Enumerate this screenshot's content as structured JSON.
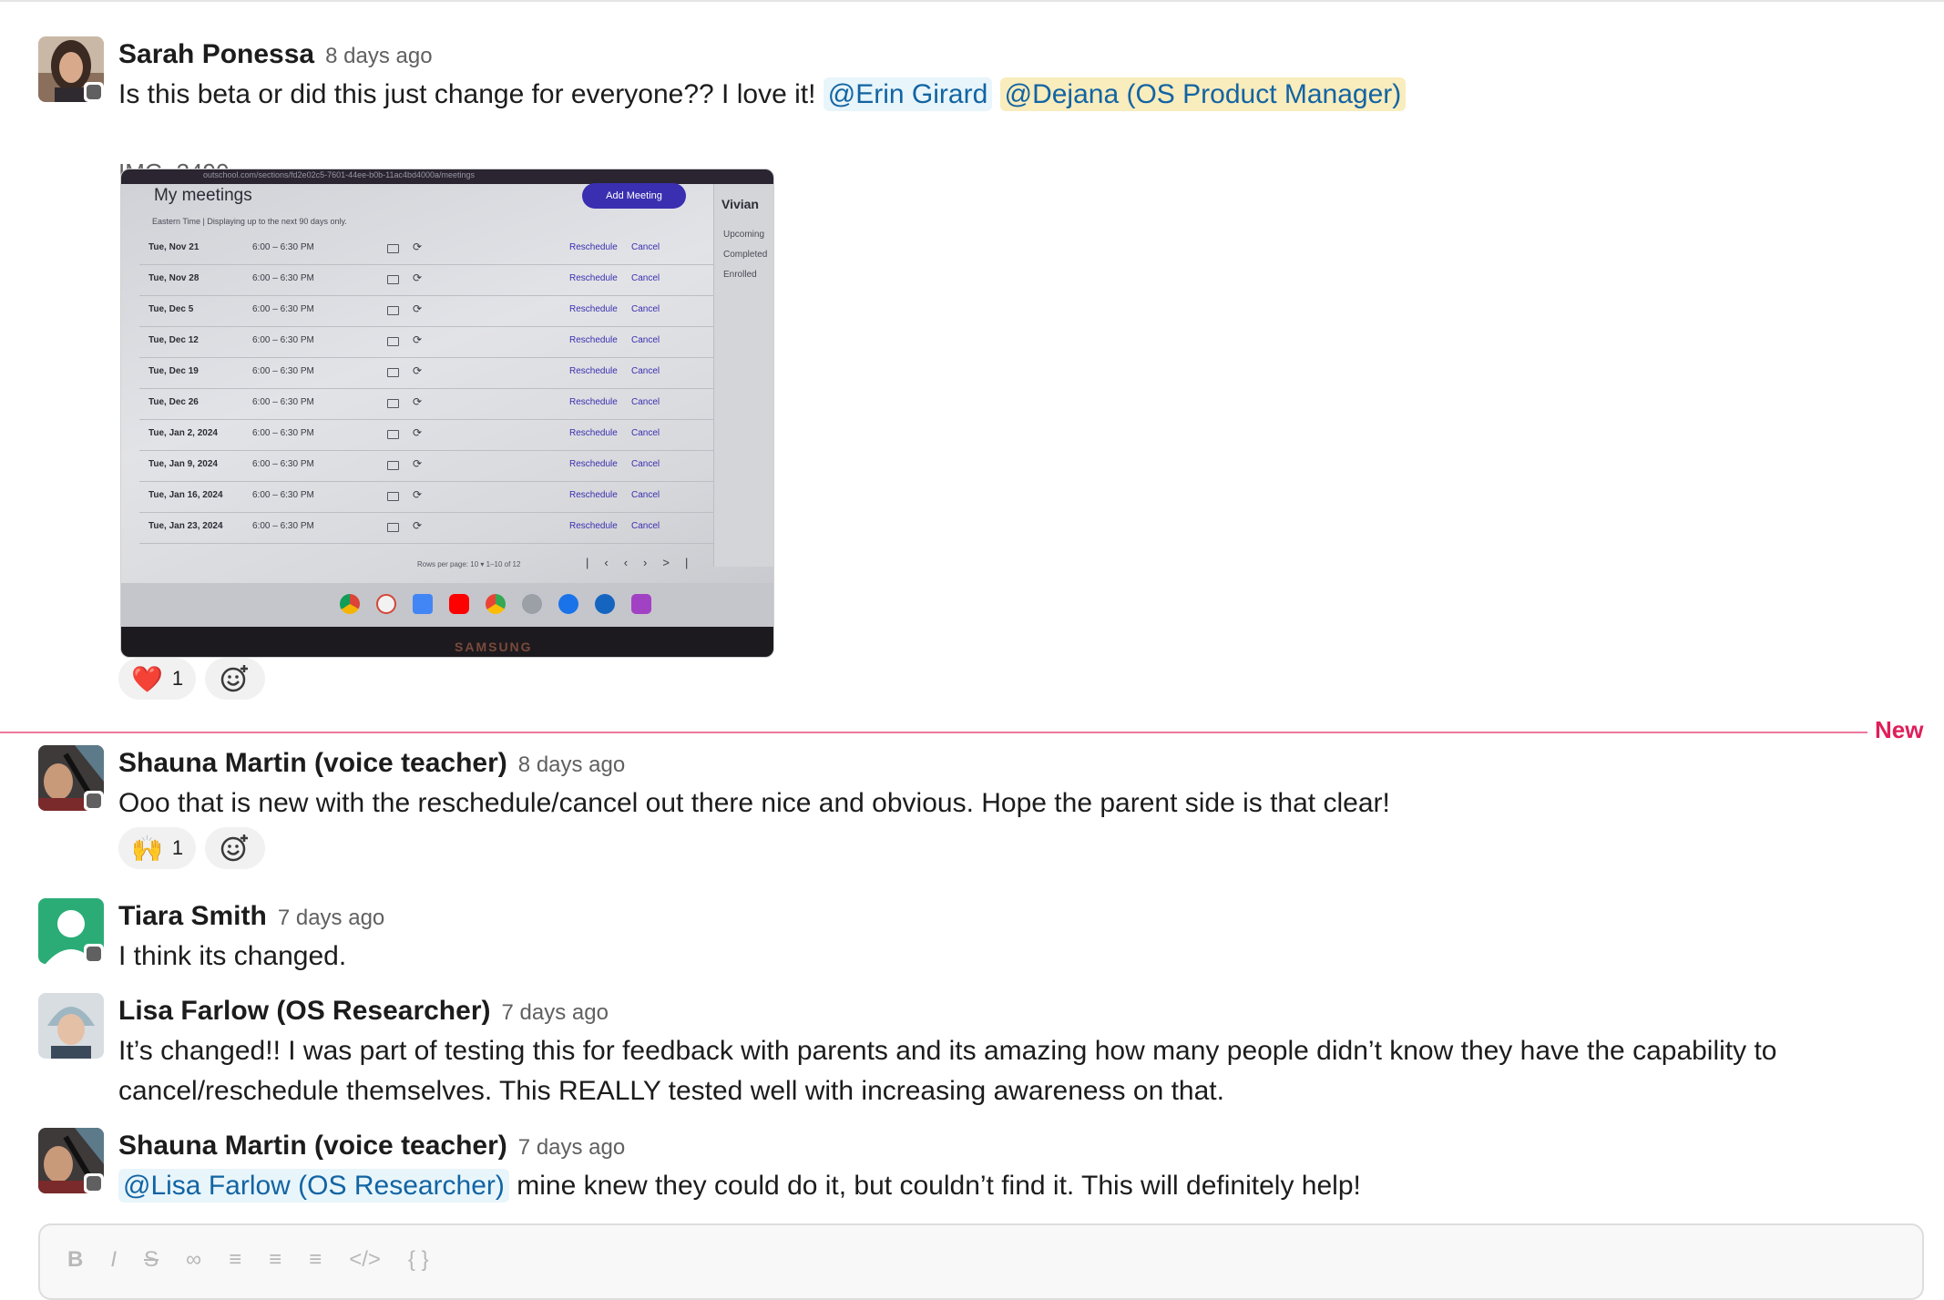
{
  "messages": [
    {
      "author": "Sarah Ponessa",
      "time": "8 days ago",
      "text_before": "Is this beta or did this just change for everyone?? I love it! ",
      "mention1": "@Erin Girard",
      "mention2": "@Dejana (OS Product Manager)",
      "file_name": "IMG_3490",
      "reaction": {
        "emoji": "❤️",
        "count": "1"
      }
    },
    {
      "author": "Shauna Martin (voice teacher)",
      "time": "8 days ago",
      "text": "Ooo that is new with the reschedule/cancel out there nice and obvious. Hope the parent side is that clear!",
      "reaction": {
        "emoji": "🙌",
        "count": "1"
      }
    },
    {
      "author": "Tiara Smith",
      "time": "7 days ago",
      "text": "I think its changed."
    },
    {
      "author": "Lisa Farlow (OS Researcher)",
      "time": "7 days ago",
      "text": "It’s changed!! I was part of testing this for feedback with parents and its amazing how many people didn’t know they have the capability to cancel/reschedule themselves. This REALLY tested well with increasing awareness on that."
    },
    {
      "author": "Shauna Martin (voice teacher)",
      "time": "7 days ago",
      "mention": "@Lisa Farlow (OS Researcher)",
      "text_after": " mine knew they could do it, but couldn’t find it. This will definitely help!"
    }
  ],
  "divider_label": "New",
  "attachment": {
    "url": "outschool.com/sections/fd2e02c5-7601-44ee-b0b-11ac4bd4000a/meetings",
    "title": "My meetings",
    "subtitle": "Eastern Time | Displaying up to the next 90 days only.",
    "add_button": "Add Meeting",
    "side_title": "Vivian",
    "side_items": [
      "Upcoming",
      "Completed",
      "Enrolled"
    ],
    "rows": [
      {
        "date": "Tue, Nov 21",
        "time": "6:00 – 6:30 PM"
      },
      {
        "date": "Tue, Nov 28",
        "time": "6:00 – 6:30 PM"
      },
      {
        "date": "Tue, Dec 5",
        "time": "6:00 – 6:30 PM"
      },
      {
        "date": "Tue, Dec 12",
        "time": "6:00 – 6:30 PM"
      },
      {
        "date": "Tue, Dec 19",
        "time": "6:00 – 6:30 PM"
      },
      {
        "date": "Tue, Dec 26",
        "time": "6:00 – 6:30 PM"
      },
      {
        "date": "Tue, Jan 2, 2024",
        "time": "6:00 – 6:30 PM"
      },
      {
        "date": "Tue, Jan 9, 2024",
        "time": "6:00 – 6:30 PM"
      },
      {
        "date": "Tue, Jan 16, 2024",
        "time": "6:00 – 6:30 PM"
      },
      {
        "date": "Tue, Jan 23, 2024",
        "time": "6:00 – 6:30 PM"
      }
    ],
    "reschedule_label": "Reschedule",
    "cancel_label": "Cancel",
    "pager_text": "Rows per page:  10 ▾      1–10 of 12",
    "bezel_text": "SAMSUNG"
  },
  "icons": {
    "add_reaction": "add-reaction-icon",
    "caret": "caret-down-icon",
    "presence": "presence-away-icon"
  },
  "colors": {
    "mention_text": "#1264a3",
    "mention_bg": "#e8f5fa",
    "mention_self_bg": "#f9ecbd",
    "new_divider": "#e01e5a"
  }
}
